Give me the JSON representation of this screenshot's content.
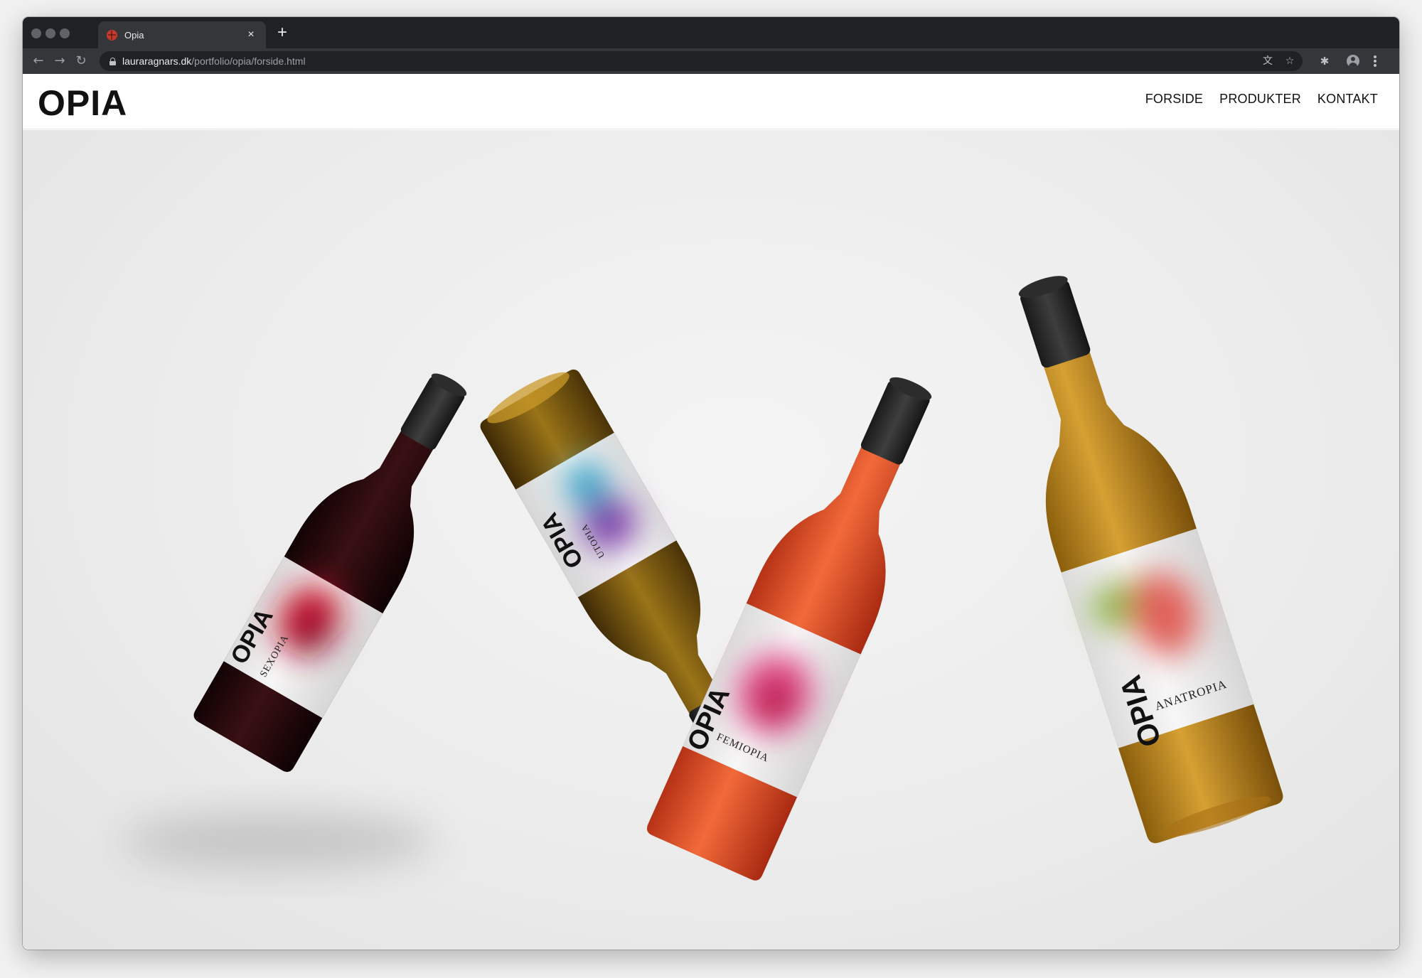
{
  "browser": {
    "tab_title": "Opia",
    "tab_close": "×",
    "new_tab": "+",
    "url_host": "lauraragnars.dk",
    "url_path": "/portfolio/opia/forside.html",
    "icons": {
      "back": "back-arrow-icon",
      "forward": "forward-arrow-icon",
      "reload": "reload-icon",
      "translate": "translate-icon",
      "bookmark": "star-icon",
      "extensions": "puzzle-icon",
      "profile": "profile-icon",
      "menu": "kebab-menu-icon"
    }
  },
  "site": {
    "logo": "OPIA",
    "nav": [
      "FORSIDE",
      "PRODUKTER",
      "KONTAKT"
    ]
  },
  "hero": {
    "bottles": [
      {
        "brand": "OPIA",
        "name": "SEXOPIA",
        "glass_color": "#2a0a0c"
      },
      {
        "brand": "OPIA",
        "name": "UTOPIA",
        "glass_color": "#6b4c10"
      },
      {
        "brand": "OPIA",
        "name": "FEMIOPIA",
        "glass_color": "#e0532a"
      },
      {
        "brand": "OPIA",
        "name": "ANATROPIA",
        "glass_color": "#b98419"
      }
    ]
  }
}
